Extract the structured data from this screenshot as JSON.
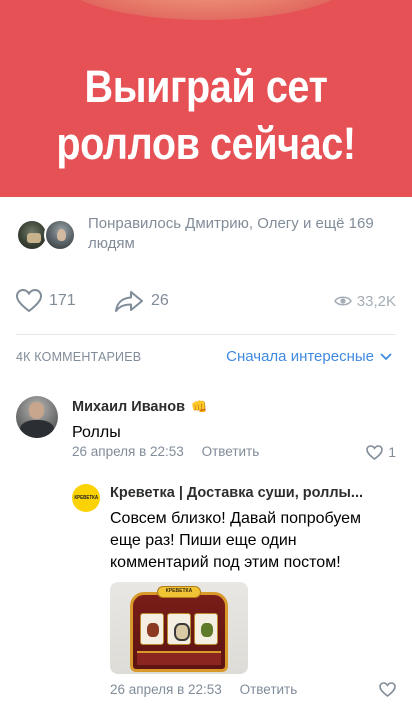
{
  "banner": {
    "headline_line1": "Выиграй сет",
    "headline_line2": "роллов сейчас!",
    "color": "#e55155"
  },
  "likers": {
    "text": "Понравилось Дмитрию, Олегу и ещё 169 людям"
  },
  "actions": {
    "likes": "171",
    "shares": "26",
    "views": "33,2K",
    "like_icon": "heart-icon",
    "share_icon": "share-arrow-icon",
    "views_icon": "eye-icon"
  },
  "comments_header": {
    "count_label": "4К КОММЕНТАРИЕВ",
    "sort_label": "Сначала интересные",
    "accent": "#3f8ae0"
  },
  "comments": [
    {
      "author": "Михаил Иванов",
      "author_badge": "👊",
      "text": "Роллы",
      "date": "26 апреля в 22:53",
      "reply_label": "Ответить",
      "likes": "1"
    },
    {
      "author": "Креветка | Доставка суши, роллы...",
      "avatar_logo": "КРЕВЕТКА",
      "text": "Совсем близко! Давай попробуем еще раз! Пиши еще один комментарий под этим постом!",
      "attachment_label": "КРЕВЕТКА",
      "date": "26 апреля в 22:53",
      "reply_label": "Ответить",
      "likes": ""
    }
  ]
}
